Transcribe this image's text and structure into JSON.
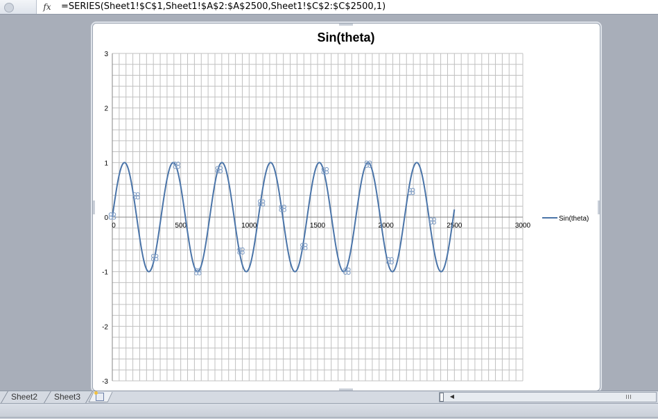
{
  "formula_bar": {
    "fx_label": "fx",
    "formula": "=SERIES(Sheet1!$C$1,Sheet1!$A$2:$A$2500,Sheet1!$C$2:$C$2500,1)"
  },
  "sheet_tabs": [
    "Sheet2",
    "Sheet3"
  ],
  "colors": {
    "series": "#4a74a8",
    "grid": "#c0c0c0",
    "axis": "#868686",
    "marker": "#7e9cc4"
  },
  "icons": {
    "fx": "function-icon",
    "insert_sheet": "insert-sheet-icon",
    "scroll_left": "arrow-left-icon"
  },
  "chart_data": {
    "type": "scatter",
    "title": "Sin(theta)",
    "xlim": [
      0,
      3000
    ],
    "ylim": [
      -3,
      3
    ],
    "x_ticks": [
      0,
      500,
      1000,
      1500,
      2000,
      2500,
      3000
    ],
    "y_ticks": [
      3,
      2,
      1,
      0,
      -1,
      -2,
      -3
    ],
    "x_minor_step": 50,
    "y_minor_step": 0.2,
    "grid": true,
    "legend_position": "right",
    "series": [
      {
        "name": "Sin(theta)",
        "style": "smooth-line",
        "x_range": [
          0,
          2500
        ],
        "period": 356,
        "amplitude": 1
      }
    ],
    "markers": [
      {
        "x": 0,
        "y": 0.02
      },
      {
        "x": 175,
        "y": 0.39
      },
      {
        "x": 310,
        "y": -0.74
      },
      {
        "x": 470,
        "y": 0.95
      },
      {
        "x": 625,
        "y": -1.0
      },
      {
        "x": 780,
        "y": 0.87
      },
      {
        "x": 940,
        "y": -0.62
      },
      {
        "x": 1090,
        "y": 0.26
      },
      {
        "x": 1245,
        "y": 0.16
      },
      {
        "x": 1400,
        "y": -0.54
      },
      {
        "x": 1555,
        "y": 0.85
      },
      {
        "x": 1715,
        "y": -0.99
      },
      {
        "x": 1870,
        "y": 0.97
      },
      {
        "x": 2030,
        "y": -0.8
      },
      {
        "x": 2185,
        "y": 0.47
      },
      {
        "x": 2340,
        "y": -0.07
      }
    ]
  }
}
